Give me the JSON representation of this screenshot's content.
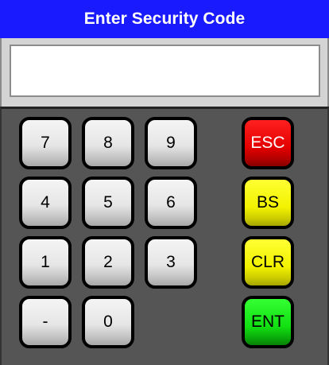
{
  "title": "Enter Security Code",
  "display": {
    "value": ""
  },
  "keys": {
    "k7": "7",
    "k8": "8",
    "k9": "9",
    "k4": "4",
    "k5": "5",
    "k6": "6",
    "k1": "1",
    "k2": "2",
    "k3": "3",
    "minus": "-",
    "k0": "0",
    "esc": "ESC",
    "bs": "BS",
    "clr": "CLR",
    "ent": "ENT"
  },
  "colors": {
    "title_bar": "#1a1aff",
    "keypad_bg": "#555555",
    "esc": "#e30000",
    "bs_clr": "#f2f200",
    "ent": "#12e012"
  }
}
